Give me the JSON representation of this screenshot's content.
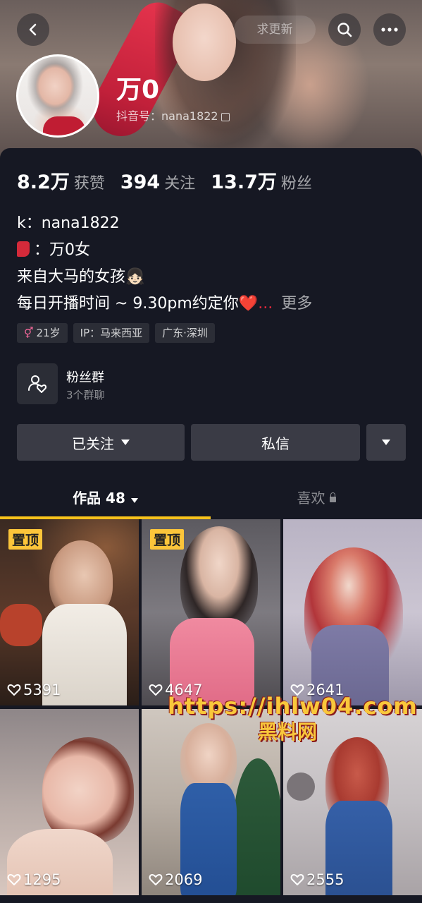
{
  "header": {
    "back_icon": "chevron-left-icon",
    "search_icon": "search-icon",
    "more_icon": "more-horizontal-icon",
    "ghost_button_label": "求更新"
  },
  "profile": {
    "nickname": "万0",
    "douyin_id_label": "抖音号：nana1822"
  },
  "stats": [
    {
      "value": "8.2万",
      "label": "获赞"
    },
    {
      "value": "394",
      "label": "关注"
    },
    {
      "value": "13.7万",
      "label": "粉丝"
    }
  ],
  "bio": {
    "line1": "k：nana1822",
    "line2": "：万0女",
    "line3": "来自大马的女孩👧🏻",
    "line4": "每日开播时间 ~ 9.30pm约定你",
    "line4_heart": "❤️...",
    "more_label": "更多"
  },
  "tags": {
    "age": "21岁",
    "gender_symbol": "⚥",
    "ip": "IP：马来西亚",
    "location": "广东·深圳"
  },
  "fan_group": {
    "title": "粉丝群",
    "subtitle": "3个群聊"
  },
  "actions": {
    "following_label": "已关注",
    "message_label": "私信"
  },
  "tabs": {
    "works_label": "作品 48",
    "likes_label": "喜欢"
  },
  "pinned_label": "置顶",
  "videos": [
    {
      "likes": "5391",
      "pinned": true
    },
    {
      "likes": "4647",
      "pinned": true
    },
    {
      "likes": "2641",
      "pinned": false
    },
    {
      "likes": "1295",
      "pinned": false
    },
    {
      "likes": "2069",
      "pinned": false
    },
    {
      "likes": "2555",
      "pinned": false
    }
  ],
  "watermark": {
    "url": "https://ihlw04.com",
    "text": "黑料网"
  },
  "colors": {
    "background": "#161823",
    "accent_yellow": "#f8c21b",
    "button_bg": "#3a3b45"
  }
}
